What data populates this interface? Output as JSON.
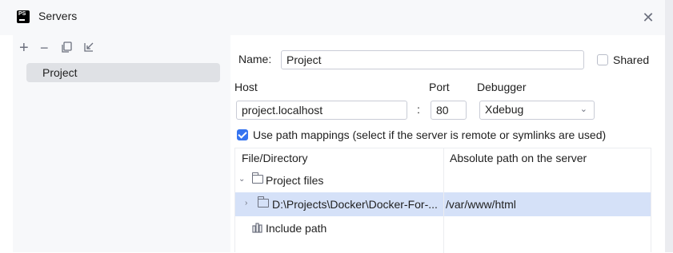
{
  "window": {
    "title": "Servers",
    "app_icon_text": "PS"
  },
  "toolbar": {
    "items": [
      {
        "name": "add-icon",
        "glyph": "+"
      },
      {
        "name": "remove-icon",
        "glyph": "−"
      },
      {
        "name": "copy-icon",
        "glyph": "⧉"
      },
      {
        "name": "import-icon",
        "glyph": "↙"
      }
    ]
  },
  "servers": {
    "items": [
      {
        "label": "Project",
        "selected": true
      }
    ]
  },
  "form": {
    "name_label": "Name:",
    "name_value": "Project",
    "shared_label": "Shared",
    "shared_checked": false,
    "host_label": "Host",
    "host_value": "project.localhost",
    "port_separator": ":",
    "port_label": "Port",
    "port_value": "80",
    "debugger_label": "Debugger",
    "debugger_value": "Xdebug",
    "path_mappings_label": "Use path mappings (select if the server is remote or symlinks are used)",
    "path_mappings_checked": true
  },
  "mappings": {
    "headers": [
      "File/Directory",
      "Absolute path on the server"
    ],
    "rows": [
      {
        "file": "Project files",
        "server_path": "",
        "icon": "folder-icon",
        "expanded": true,
        "selected": false
      },
      {
        "file": "D:\\Projects\\Docker\\Docker-For-...",
        "server_path": "/var/www/html",
        "icon": "folder-icon",
        "expanded": false,
        "selected": true
      },
      {
        "file": "Include path",
        "server_path": "",
        "icon": "library-icon",
        "expanded": false,
        "selected": false
      }
    ]
  },
  "colors": {
    "accent": "#3574f0",
    "selection": "#d5e1f8",
    "panel": "#f7f8fa"
  }
}
